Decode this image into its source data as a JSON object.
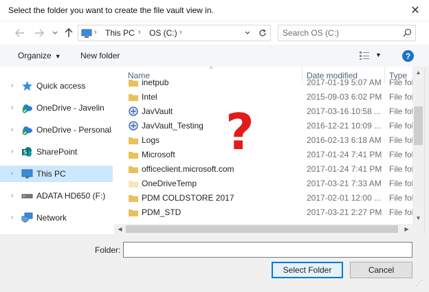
{
  "window": {
    "title": "Select the folder you want to create the file vault view in.",
    "close_label": "✕"
  },
  "address": {
    "segments": [
      "This PC",
      "OS (C:)"
    ]
  },
  "search": {
    "placeholder": "Search OS (C:)"
  },
  "commands": {
    "organize": "Organize",
    "new_folder": "New folder"
  },
  "nav": {
    "items": [
      {
        "label": "Quick access",
        "icon": "star-icon",
        "selected": false
      },
      {
        "label": "OneDrive - Javelin",
        "icon": "onedrive-icon",
        "selected": false
      },
      {
        "label": "OneDrive - Personal",
        "icon": "onedrive-icon",
        "selected": false
      },
      {
        "label": "SharePoint",
        "icon": "sharepoint-icon",
        "selected": false
      },
      {
        "label": "This PC",
        "icon": "computer-icon",
        "selected": true
      },
      {
        "label": "ADATA HD650 (F:)",
        "icon": "drive-icon",
        "selected": false
      },
      {
        "label": "Network",
        "icon": "network-icon",
        "selected": false
      }
    ]
  },
  "columns": {
    "name": "Name",
    "date": "Date modified",
    "type": "Type"
  },
  "files": [
    {
      "name": "inetpub",
      "date": "2017-01-19 5:07 AM",
      "type": "File fol",
      "icon": "folder-icon"
    },
    {
      "name": "Intel",
      "date": "2015-09-03 6:02 PM",
      "type": "File fol",
      "icon": "folder-icon"
    },
    {
      "name": "JavVault",
      "date": "2017-03-16 10:58 ...",
      "type": "File fol",
      "icon": "vault-icon"
    },
    {
      "name": "JavVault_Testing",
      "date": "2016-12-21 10:09 ...",
      "type": "File fol",
      "icon": "vault-icon"
    },
    {
      "name": "Logs",
      "date": "2016-02-13 6:18 AM",
      "type": "File fol",
      "icon": "folder-icon"
    },
    {
      "name": "Microsoft",
      "date": "2017-01-24 7:41 PM",
      "type": "File fol",
      "icon": "folder-icon"
    },
    {
      "name": "officeclient.microsoft.com",
      "date": "2017-01-24 7:41 PM",
      "type": "File fol",
      "icon": "folder-icon"
    },
    {
      "name": "OneDriveTemp",
      "date": "2017-03-21 7:33 AM",
      "type": "File fol",
      "icon": "folder-light-icon"
    },
    {
      "name": "PDM COLDSTORE 2017",
      "date": "2017-02-01 12:00 ...",
      "type": "File fol",
      "icon": "folder-icon"
    },
    {
      "name": "PDM_STD",
      "date": "2017-03-21 2:27 PM",
      "type": "File fol",
      "icon": "folder-icon"
    },
    {
      "name": "",
      "date": "",
      "type": "",
      "icon": "folder-icon"
    }
  ],
  "overlay": {
    "mark": "?"
  },
  "footer": {
    "folder_label": "Folder:",
    "folder_value": "",
    "select_label": "Select Folder",
    "cancel_label": "Cancel"
  },
  "colors": {
    "accent": "#0078d7",
    "selected_bg": "#cce8ff",
    "question_mark": "#e21b1b",
    "folder": "#e8c15c"
  }
}
